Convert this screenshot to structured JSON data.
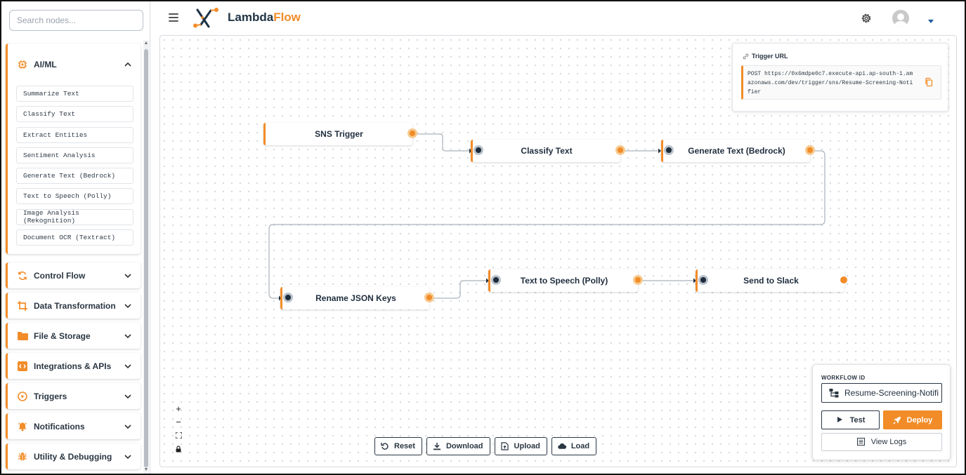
{
  "header": {
    "brand_part1": "Lambda",
    "brand_part2": "Flow",
    "accent_color": "#f28c28",
    "dark_color": "#1f3344"
  },
  "sidebar": {
    "search_placeholder": "Search nodes...",
    "categories": [
      {
        "label": "AI/ML",
        "icon": "chip-icon",
        "expanded": true,
        "items": [
          "Summarize Text",
          "Classify Text",
          "Extract Entities",
          "Sentiment Analysis",
          "Generate Text (Bedrock)",
          "Text to Speech (Polly)",
          "Image Analysis (Rekognition)",
          "Document OCR (Textract)"
        ]
      },
      {
        "label": "Control Flow",
        "icon": "sync-icon",
        "expanded": false
      },
      {
        "label": "Data Transformation",
        "icon": "crop-icon",
        "expanded": false
      },
      {
        "label": "File & Storage",
        "icon": "folder-icon",
        "expanded": false
      },
      {
        "label": "Integrations & APIs",
        "icon": "code-icon",
        "expanded": false
      },
      {
        "label": "Triggers",
        "icon": "play-circle-icon",
        "expanded": false
      },
      {
        "label": "Notifications",
        "icon": "bell-icon",
        "expanded": false
      },
      {
        "label": "Utility & Debugging",
        "icon": "bug-icon",
        "expanded": false
      }
    ]
  },
  "canvas": {
    "nodes": [
      {
        "id": "sns",
        "label": "SNS Trigger"
      },
      {
        "id": "classify",
        "label": "Classify Text"
      },
      {
        "id": "generate",
        "label": "Generate Text (Bedrock)"
      },
      {
        "id": "rename",
        "label": "Rename JSON Keys"
      },
      {
        "id": "tts",
        "label": "Text to Speech (Polly)"
      },
      {
        "id": "slack",
        "label": "Send to Slack"
      }
    ],
    "trigger_card": {
      "title": "Trigger URL",
      "url_text": "POST https://0x6mdpe0c7.execute-api.ap-south-1.amazonaws.com/dev/trigger/sns/Resume-Screening-Notifier"
    },
    "zoom_controls": [
      "+",
      "−",
      "fit",
      "lock"
    ],
    "toolbar": {
      "reset": "Reset",
      "download": "Download",
      "upload": "Upload",
      "load": "Load"
    }
  },
  "workflow_panel": {
    "label": "WORKFLOW ID",
    "workflow_id": "Resume-Screening-Notifi",
    "test": "Test",
    "deploy": "Deploy",
    "view_logs": "View Logs"
  }
}
